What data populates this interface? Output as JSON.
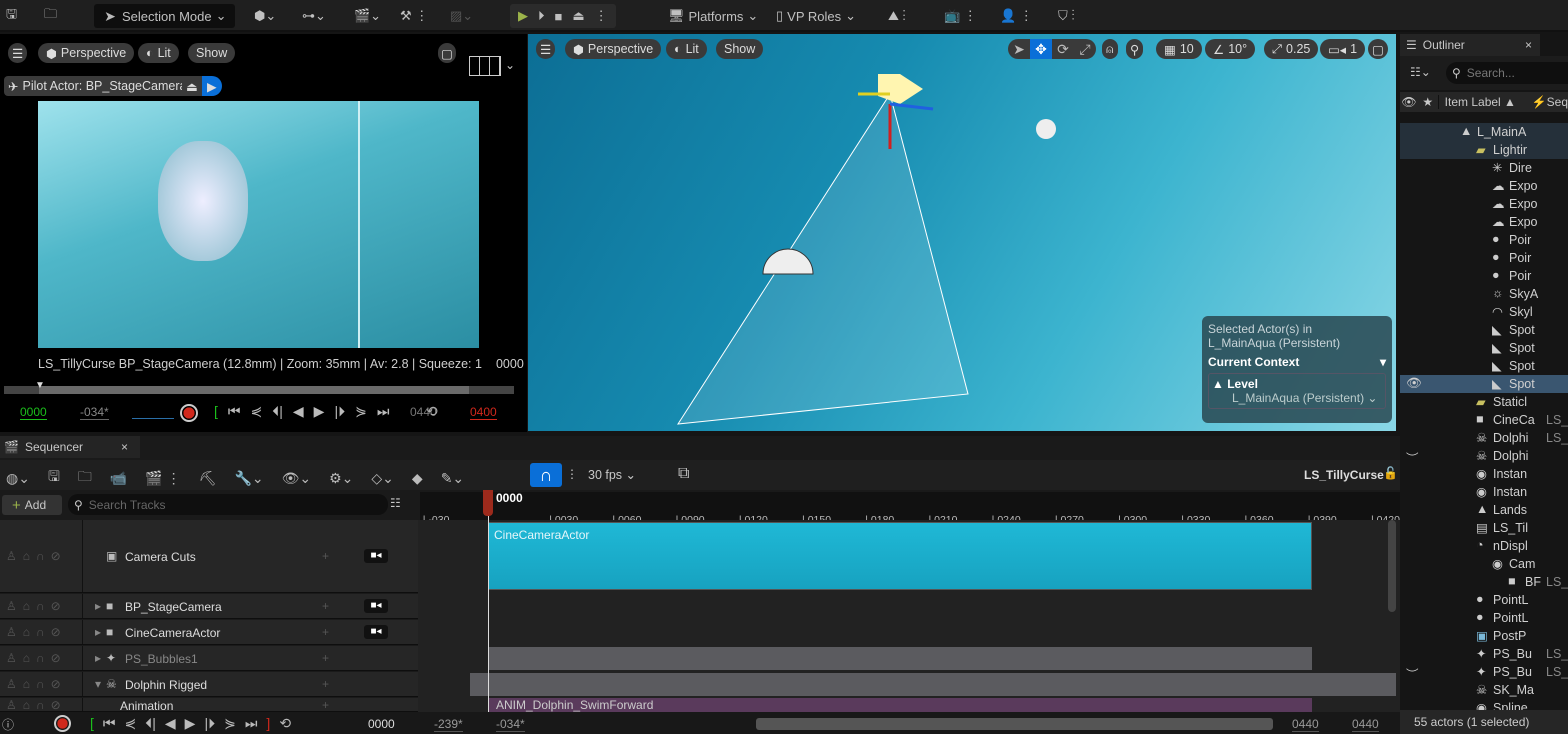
{
  "toolbar": {
    "selection_mode": "Selection Mode",
    "platforms": "Platforms",
    "vp_roles": "VP Roles"
  },
  "left_viewport": {
    "menu": "Perspective",
    "lit": "Lit",
    "show": "Show",
    "pilot": "Pilot Actor: BP_StageCamera",
    "overlay": "LS_TillyCurse BP_StageCamera (12.8mm) | Zoom: 35mm | Av: 2.8 | Squeeze: 1",
    "frame": "0000",
    "start": "0000",
    "offset": "-034*",
    "loop_end": "0440",
    "end": "0400"
  },
  "main_viewport": {
    "menu": "Perspective",
    "lit": "Lit",
    "show": "Show",
    "grid": "10",
    "angle": "10°",
    "scale": "0.25",
    "cam_speed": "1",
    "context": {
      "line1": "Selected Actor(s) in",
      "line2": "L_MainAqua (Persistent)",
      "title": "Current Context",
      "level_label": "Level",
      "level_value": "L_MainAqua (Persistent)"
    }
  },
  "outliner": {
    "title": "Outliner",
    "search_placeholder": "Search...",
    "col_label": "Item Label ▲",
    "col_seq": "Seq",
    "status": "55 actors (1 selected)",
    "items": [
      {
        "label": "L_MainA",
        "icon": "▲",
        "indent": 3,
        "sel": "ctx"
      },
      {
        "label": "Lightir",
        "icon": "▰",
        "indent": 4,
        "sel": "ctx",
        "color": "#c8c060"
      },
      {
        "label": "Dire",
        "icon": "✳",
        "indent": 5
      },
      {
        "label": "Expo",
        "icon": "☁",
        "indent": 5
      },
      {
        "label": "Expo",
        "icon": "☁",
        "indent": 5
      },
      {
        "label": "Expo",
        "icon": "☁",
        "indent": 5
      },
      {
        "label": "Poir",
        "icon": "●",
        "indent": 5
      },
      {
        "label": "Poir",
        "icon": "●",
        "indent": 5
      },
      {
        "label": "Poir",
        "icon": "●",
        "indent": 5
      },
      {
        "label": "SkyA",
        "icon": "☼",
        "indent": 5
      },
      {
        "label": "Skyl",
        "icon": "◠",
        "indent": 5
      },
      {
        "label": "Spot",
        "icon": "◣",
        "indent": 5
      },
      {
        "label": "Spot",
        "icon": "◣",
        "indent": 5
      },
      {
        "label": "Spot",
        "icon": "◣",
        "indent": 5
      },
      {
        "label": "Spot",
        "icon": "◣",
        "indent": 5,
        "sel": "yes",
        "eye": "visible"
      },
      {
        "label": "Staticl",
        "icon": "▰",
        "indent": 4,
        "color": "#c8c060"
      },
      {
        "label": "CineCa",
        "icon": "■",
        "indent": 4,
        "seq": "LS_"
      },
      {
        "label": "Dolphi",
        "icon": "☠",
        "indent": 4,
        "seq": "LS_"
      },
      {
        "label": "Dolphi",
        "icon": "☠",
        "indent": 4,
        "eye": "hidden"
      },
      {
        "label": "Instan",
        "icon": "◉",
        "indent": 4
      },
      {
        "label": "Instan",
        "icon": "◉",
        "indent": 4
      },
      {
        "label": "Lands",
        "icon": "▲",
        "indent": 4
      },
      {
        "label": "LS_Til",
        "icon": "▤",
        "indent": 4
      },
      {
        "label": "nDispl",
        "icon": "◔",
        "indent": 4
      },
      {
        "label": "Cam",
        "icon": "◉",
        "indent": 5
      },
      {
        "label": "BF",
        "icon": "■",
        "indent": 6,
        "seq": "LS_"
      },
      {
        "label": "PointL",
        "icon": "●",
        "indent": 4
      },
      {
        "label": "PointL",
        "icon": "●",
        "indent": 4
      },
      {
        "label": "PostP",
        "icon": "▣",
        "indent": 4,
        "color": "#7ab8d8"
      },
      {
        "label": "PS_Bu",
        "icon": "✦",
        "indent": 4,
        "seq": "LS_"
      },
      {
        "label": "PS_Bu",
        "icon": "✦",
        "indent": 4,
        "seq": "LS_",
        "eye": "hidden"
      },
      {
        "label": "SK_Ma",
        "icon": "☠",
        "indent": 4
      },
      {
        "label": "Spline",
        "icon": "◉",
        "indent": 4
      }
    ]
  },
  "sequencer": {
    "tab": "Sequencer",
    "fps": "30 fps",
    "sequence": "LS_TillyCurse",
    "add": "Add",
    "search_placeholder": "Search Tracks",
    "playhead": "0000",
    "ticks": [
      "-030",
      "0030",
      "0060",
      "0090",
      "0120",
      "0150",
      "0180",
      "0210",
      "0240",
      "0270",
      "0300",
      "0330",
      "0360",
      "0390",
      "0420"
    ],
    "tracks": [
      {
        "label": "Camera Cuts",
        "cam": true
      },
      {
        "label": "BP_StageCamera",
        "cam": true
      },
      {
        "label": "CineCameraActor",
        "cam": true
      },
      {
        "label": "PS_Bubbles1",
        "cam": false
      },
      {
        "label": "Dolphin Rigged",
        "cam": false
      },
      {
        "label": "Animation",
        "cam": false
      }
    ],
    "clips": {
      "camera": "CineCameraActor",
      "anim": "ANIM_Dolphin_SwimForward"
    },
    "bottom": {
      "frame": "0000",
      "view_start": "-239*",
      "work_start": "-034*",
      "work_end": "0440",
      "view_end": "0440"
    }
  },
  "colors": {
    "accent": "#0a6fd8",
    "teal_clip": "#19b4d4",
    "anim_clip": "#5a3a5c",
    "record": "#d0281c"
  }
}
